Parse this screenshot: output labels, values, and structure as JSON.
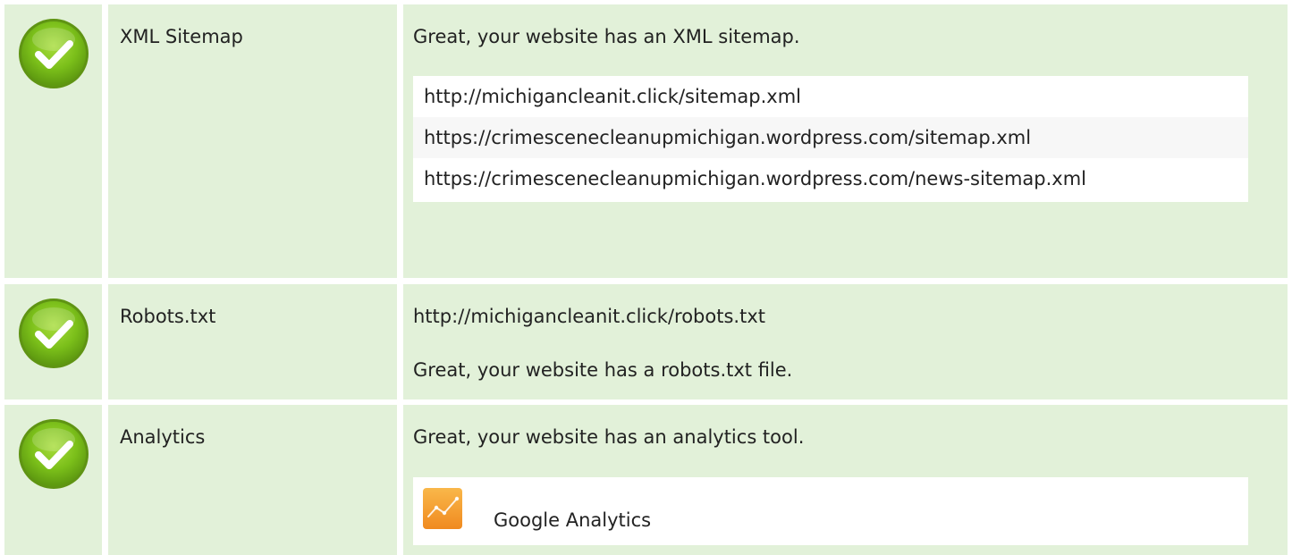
{
  "checks": {
    "sitemap": {
      "status": "passed",
      "status_icon": "check-circle-icon",
      "label": "XML Sitemap",
      "message": "Great, your website has an XML sitemap.",
      "urls": [
        "http://michigancleanit.click/sitemap.xml",
        "https://crimescenecleanupmichigan.wordpress.com/sitemap.xml",
        "https://crimescenecleanupmichigan.wordpress.com/news-sitemap.xml"
      ]
    },
    "robots": {
      "status": "passed",
      "status_icon": "check-circle-icon",
      "label": "Robots.txt",
      "url": "http://michigancleanit.click/robots.txt",
      "message": "Great, your website has a robots.txt file."
    },
    "analytics": {
      "status": "passed",
      "status_icon": "check-circle-icon",
      "label": "Analytics",
      "message": "Great, your website has an analytics tool.",
      "tools": [
        {
          "name": "Google Analytics",
          "icon": "google-analytics-icon"
        }
      ]
    }
  },
  "colors": {
    "row_background": "#e2f1d9",
    "check_green": "#7bbf1a",
    "analytics_orange": "#f4a234"
  }
}
